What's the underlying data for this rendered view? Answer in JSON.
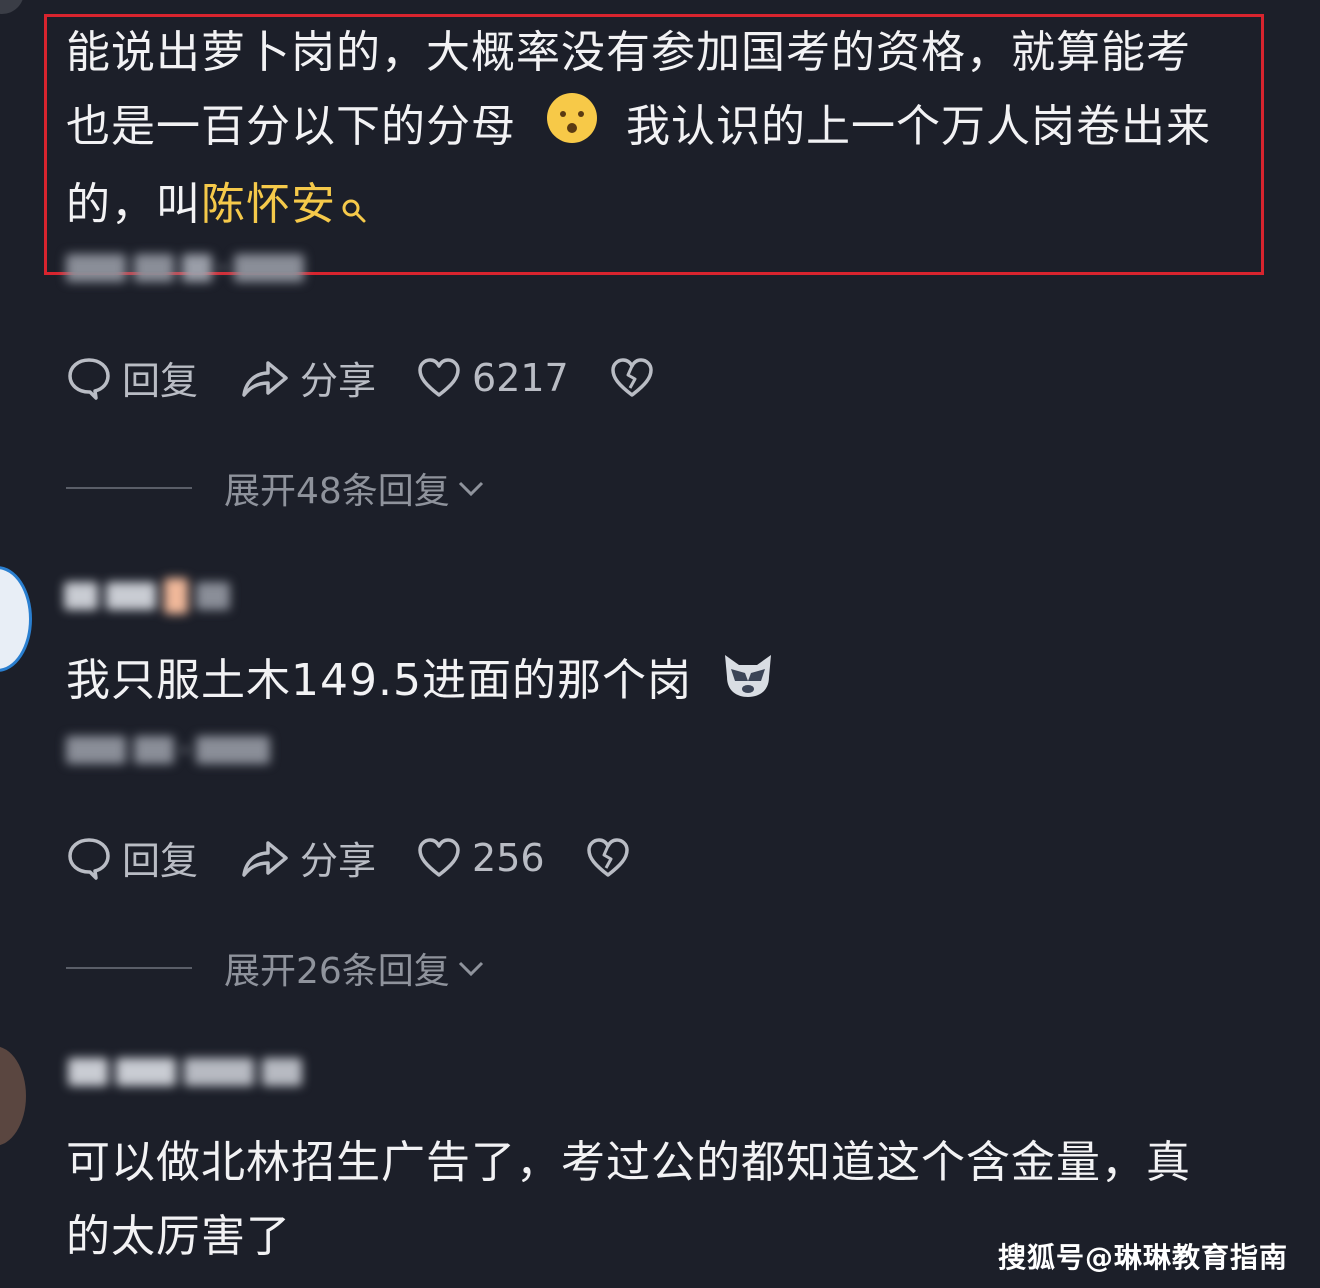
{
  "comments": [
    {
      "lines": [
        "能说出萝卜岗的，大概率没有参加国考的资格，就算能考",
        "也是一百分以下的分母",
        "我认识的上一个万人岗卷出来",
        "的，叫"
      ],
      "link_text": "陈怀安",
      "emoji_icon": "face-emoji-icon",
      "link_icon": "search-icon",
      "reply_label": "回复",
      "share_label": "分享",
      "likes": "6217",
      "expand_label": "展开48条回复"
    },
    {
      "text": "我只服土木149.5进面的那个岗",
      "emoji_icon": "wolf-emoji-icon",
      "reply_label": "回复",
      "share_label": "分享",
      "likes": "256",
      "expand_label": "展开26条回复"
    },
    {
      "lines": [
        "可以做北林招生广告了，考过公的都知道这个含金量，真",
        "的太厉害了"
      ]
    }
  ],
  "watermark": "搜狐号@琳琳教育指南",
  "colors": {
    "background": "#1c1f29",
    "link": "#f5c94a",
    "highlight_box": "#d8242e"
  }
}
